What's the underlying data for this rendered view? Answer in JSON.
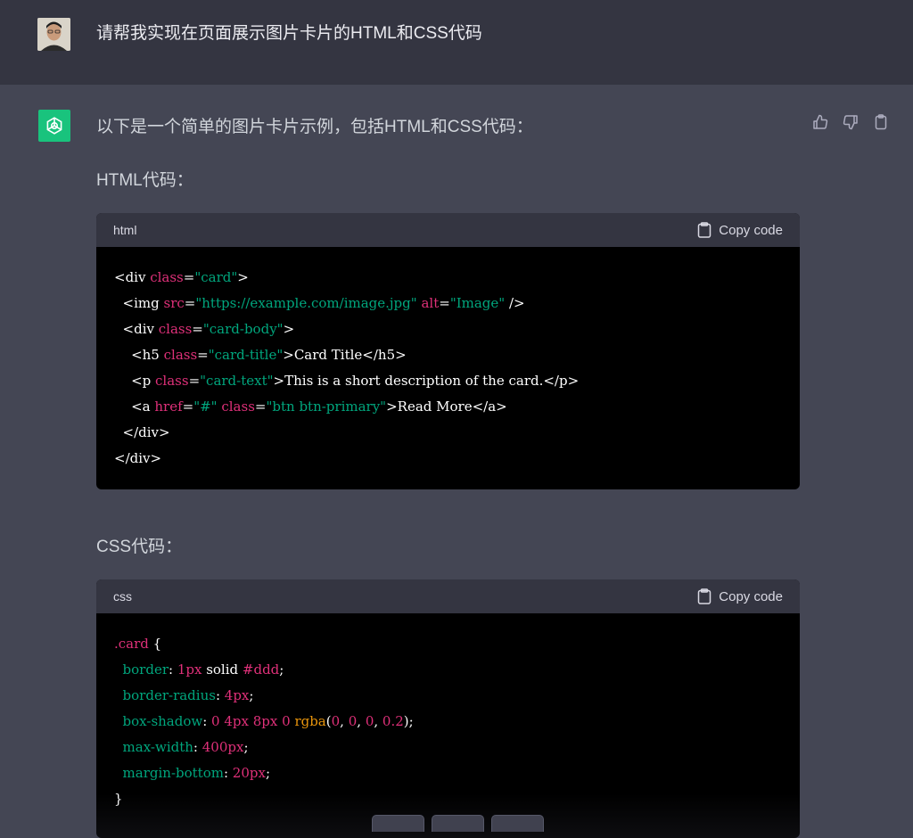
{
  "user": {
    "prompt": "请帮我实现在页面展示图片卡片的HTML和CSS代码"
  },
  "assistant": {
    "intro": "以下是一个简单的图片卡片示例，包括HTML和CSS代码：",
    "html_heading": "HTML代码：",
    "css_heading": "CSS代码：",
    "actions": [
      "thumbs-up-icon",
      "thumbs-down-icon",
      "clipboard-icon"
    ]
  },
  "html_block": {
    "lang": "html",
    "copy_label": "Copy code"
  },
  "css_block": {
    "lang": "css",
    "copy_label": "Copy code"
  },
  "colors": {
    "page_bg": "#444654",
    "user_bg": "#343541",
    "code_bg": "#000000",
    "accent_green": "#19c37d",
    "syntax_attr": "#df3079",
    "syntax_string": "#00a67d",
    "syntax_fn": "#e9950c"
  }
}
